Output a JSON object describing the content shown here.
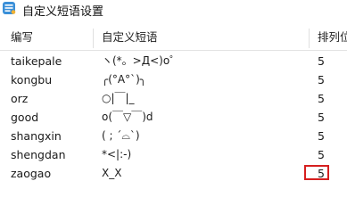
{
  "window": {
    "title": "自定义短语设置",
    "icon": "app-icon"
  },
  "table": {
    "columns": [
      "编写",
      "自定义短语",
      "排列位"
    ],
    "rows": [
      {
        "code": "taikepale",
        "phrase": "ヽ(*。>Д<)o゜",
        "order": "5"
      },
      {
        "code": "kongbu",
        "phrase": "╭(°A°`)╮",
        "order": "5"
      },
      {
        "code": "orz",
        "phrase": "○|￣|_",
        "order": "5"
      },
      {
        "code": "good",
        "phrase": "o(￣▽￣)d",
        "order": "5"
      },
      {
        "code": "shangxin",
        "phrase": "( ; ´⌓`)",
        "order": "5"
      },
      {
        "code": "shengdan",
        "phrase": "*<|:-)",
        "order": "5"
      },
      {
        "code": "zaogao",
        "phrase": "X_X",
        "order": "5"
      }
    ],
    "highlighted_row_index": 6,
    "highlight_color": "#d61f1f"
  }
}
